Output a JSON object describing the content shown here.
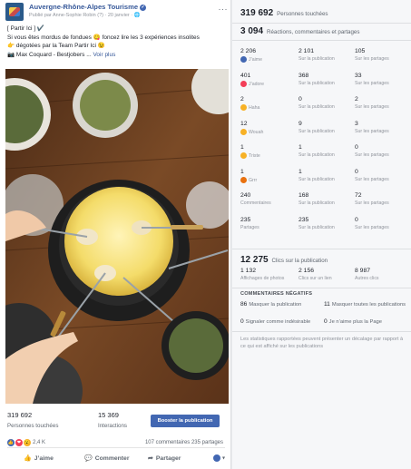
{
  "post": {
    "page_name": "Auvergne-Rhône-Alpes Tourisme",
    "byline": "Publié par Anne-Sophie Robin",
    "byline_extra": "(?)",
    "date": "· 20 janvier ·",
    "menu": "···",
    "text_lines": [
      "[ Partir Ici ] ✔️",
      "Si vous êtes mordus de fondues 😋 foncez lire les 3 expériences insolites",
      "👉 dégotées par la Team Partir Ici 😉",
      "📷 Max Coquard - Bestjobers ... "
    ],
    "see_more": "Voir plus",
    "stats": {
      "reach_value": "319 692",
      "reach_label": "Personnes touchées",
      "interactions_value": "15 369",
      "interactions_label": "Interactions"
    },
    "boost_label": "Booster la publication",
    "reaction_count": "2,4 K",
    "comments": "107 commentaires",
    "shares": "235 partages",
    "actions": {
      "like": "J’aime",
      "comment": "Commenter",
      "share": "Partager"
    },
    "colors": {
      "link": "#365899",
      "button": "#4267b2"
    }
  },
  "insights": {
    "reach_value": "319 692",
    "reach_label": "Personnes touchées",
    "engagement_value": "3 094",
    "engagement_label": "Réactions, commentaires et partages",
    "rows": [
      {
        "emoji_color": "#4267b2",
        "v1": "2 206",
        "l1": "J’aime",
        "v2": "2 101",
        "l2": "Sur la publication",
        "v3": "105",
        "l3": "Sur les partages"
      },
      {
        "emoji_color": "#f33e58",
        "v1": "401",
        "l1": "J’adore",
        "v2": "368",
        "l2": "Sur la publication",
        "v3": "33",
        "l3": "Sur les partages"
      },
      {
        "emoji_color": "#f7b125",
        "v1": "2",
        "l1": "Haha",
        "v2": "0",
        "l2": "Sur la publication",
        "v3": "2",
        "l3": "Sur les partages"
      },
      {
        "emoji_color": "#f7b125",
        "v1": "12",
        "l1": "Wouah",
        "v2": "9",
        "l2": "Sur la publication",
        "v3": "3",
        "l3": "Sur les partages"
      },
      {
        "emoji_color": "#f7b125",
        "v1": "1",
        "l1": "Triste",
        "v2": "1",
        "l2": "Sur la publication",
        "v3": "0",
        "l3": "Sur les partages"
      },
      {
        "emoji_color": "#e9710f",
        "v1": "1",
        "l1": "Grrr",
        "v2": "1",
        "l2": "Sur la publication",
        "v3": "0",
        "l3": "Sur les partages"
      },
      {
        "emoji_color": "",
        "v1": "240",
        "l1": "Commentaires",
        "v2": "168",
        "l2": "Sur la publication",
        "v3": "72",
        "l3": "Sur les partages"
      },
      {
        "emoji_color": "",
        "v1": "235",
        "l1": "Partages",
        "v2": "235",
        "l2": "Sur la publication",
        "v3": "0",
        "l3": "Sur les partages"
      }
    ],
    "clicks_value": "12 275",
    "clicks_label": "Clics sur la publication",
    "clicks": [
      {
        "v": "1 132",
        "l": "Affichages de photos"
      },
      {
        "v": "2 156",
        "l": "Clics sur un lien"
      },
      {
        "v": "8 987",
        "l": "Autres clics"
      }
    ],
    "negative_title": "COMMENTAIRES NÉGATIFS",
    "negative": [
      {
        "v": "86",
        "l": "Masquer la publication"
      },
      {
        "v": "11",
        "l": "Masquer toutes les publications"
      },
      {
        "v": "0",
        "l": "Signaler comme indésirable"
      },
      {
        "v": "0",
        "l": "Je n’aime plus la Page"
      }
    ],
    "footnote": "Les statistiques rapportées peuvent présenter un décalage par rapport à ce qui est affiché sur les publications"
  }
}
